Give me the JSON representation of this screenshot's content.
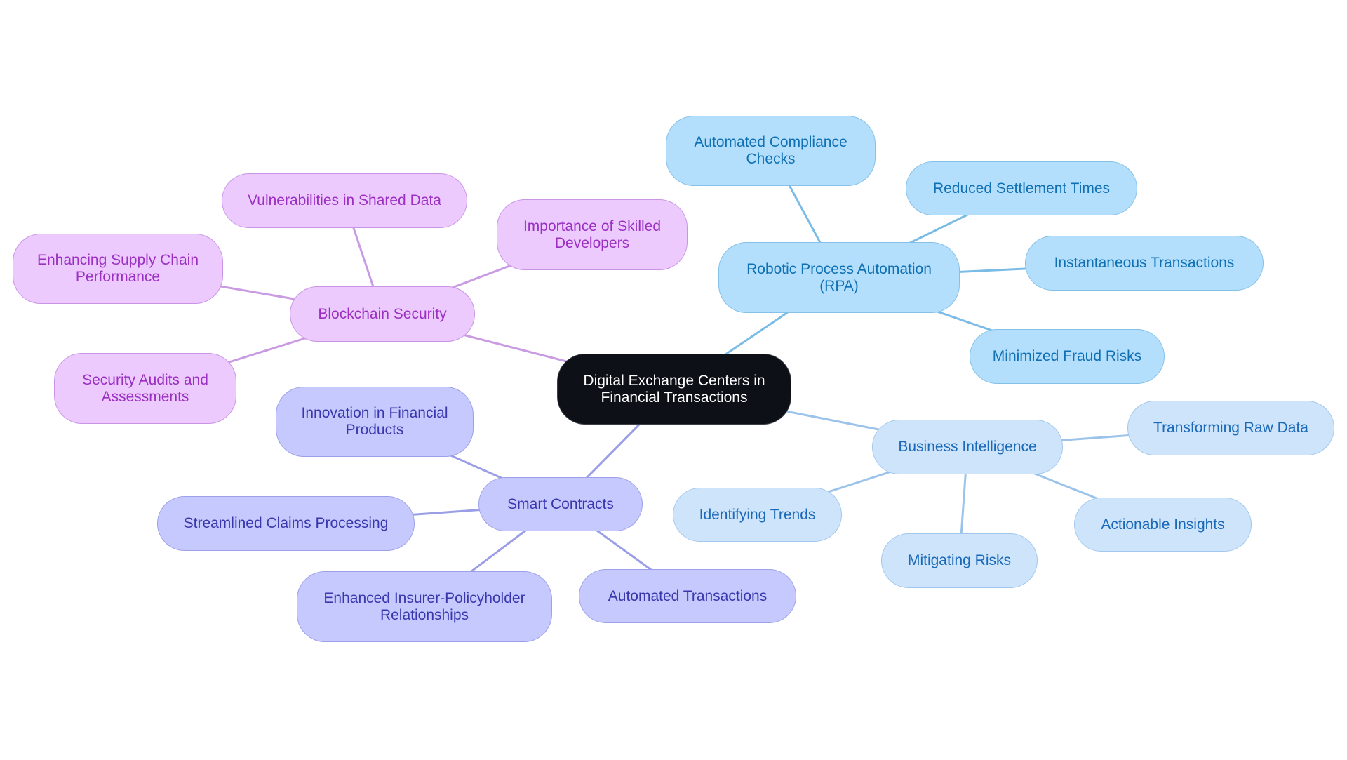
{
  "root": {
    "label": "Digital Exchange Centers in Financial Transactions",
    "color": "#0d1117"
  },
  "branches": [
    {
      "id": "blockchain",
      "label": "Blockchain Security",
      "color": "#c99be3",
      "children": [
        "Vulnerabilities in Shared Data",
        "Importance of Skilled Developers",
        "Enhancing Supply Chain Performance",
        "Security Audits and Assessments"
      ]
    },
    {
      "id": "rpa",
      "label": "Robotic Process Automation (RPA)",
      "color": "#7bbce6",
      "children": [
        "Automated Compliance Checks",
        "Reduced Settlement Times",
        "Instantaneous Transactions",
        "Minimized Fraud Risks"
      ]
    },
    {
      "id": "bi",
      "label": "Business Intelligence",
      "color": "#9cc3ea",
      "children": [
        "Transforming Raw Data",
        "Actionable Insights",
        "Mitigating Risks",
        "Identifying Trends"
      ]
    },
    {
      "id": "smart",
      "label": "Smart Contracts",
      "color": "#9a9ee6",
      "children": [
        "Innovation in Financial Products",
        "Streamlined Claims Processing",
        "Enhanced Insurer-Policyholder Relationships",
        "Automated Transactions"
      ]
    }
  ]
}
